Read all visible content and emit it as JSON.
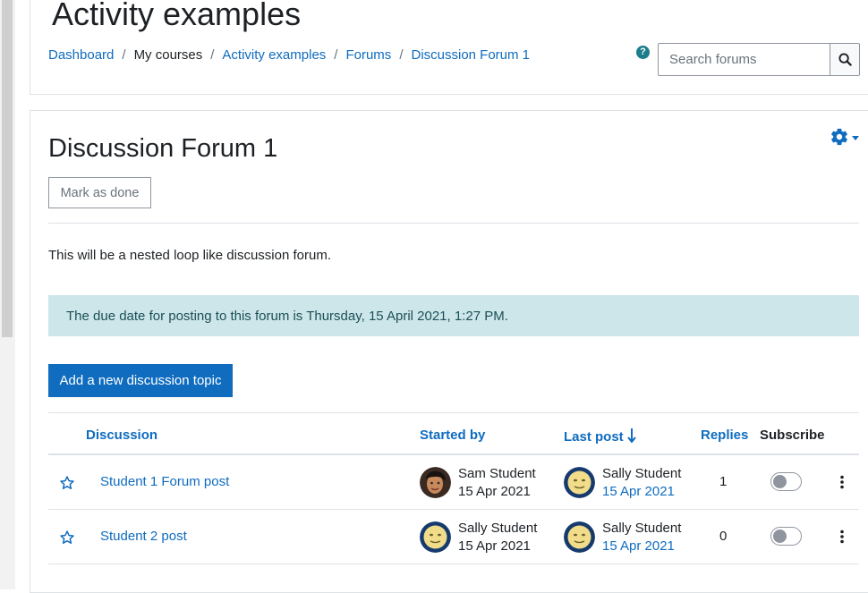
{
  "header": {
    "site_title": "Activity examples",
    "breadcrumbs": [
      "Dashboard",
      "My courses",
      "Activity examples",
      "Forums",
      "Discussion Forum 1"
    ],
    "separator": "/",
    "help_icon": "?",
    "search": {
      "placeholder": "Search forums",
      "value": ""
    }
  },
  "forum": {
    "title": "Discussion Forum 1",
    "mark_done_label": "Mark as done",
    "intro": "This will be a nested loop like discussion forum.",
    "due_notice": "The due date for posting to this forum is Thursday, 15 April 2021, 1:27 PM.",
    "add_topic_label": "Add a new discussion topic"
  },
  "table": {
    "headers": {
      "discussion": "Discussion",
      "started_by": "Started by",
      "last_post": "Last post",
      "replies": "Replies",
      "subscribe": "Subscribe"
    },
    "sort_indicator": "↓",
    "rows": [
      {
        "topic": "Student 1 Forum post",
        "started_by": {
          "name": "Sam Student",
          "date": "15 Apr 2021"
        },
        "last_post": {
          "name": "Sally Student",
          "date": "15 Apr 2021"
        },
        "replies": "1",
        "subscribed": false
      },
      {
        "topic": "Student 2 post",
        "started_by": {
          "name": "Sally Student",
          "date": "15 Apr 2021"
        },
        "last_post": {
          "name": "Sally Student",
          "date": "15 Apr 2021"
        },
        "replies": "0",
        "subscribed": false
      }
    ]
  },
  "colors": {
    "primary": "#0f6cbf",
    "alert_bg": "#cce6ea",
    "alert_text": "#1d4f56",
    "help_icon": "#1c7d8c"
  },
  "icons": {
    "search": "search-icon",
    "gear": "gear-icon",
    "star": "star-icon",
    "kebab": "kebab-icon",
    "help": "help-icon"
  }
}
